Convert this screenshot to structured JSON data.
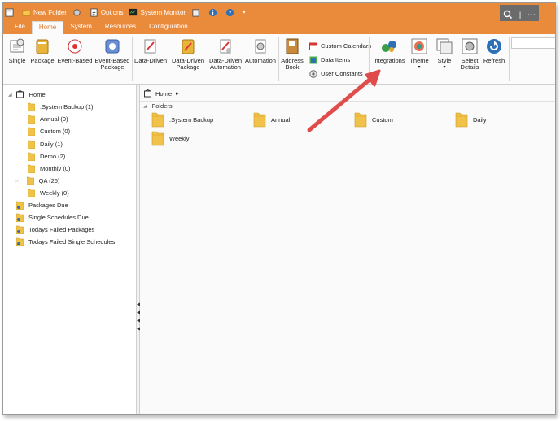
{
  "quick_access": {
    "new_folder": "New Folder",
    "options": "Options",
    "system_monitor": "System Monitor",
    "window_more": "⋯"
  },
  "tabs": [
    "File",
    "Home",
    "System",
    "Resources",
    "Configuration"
  ],
  "ribbon": {
    "buttons": [
      {
        "label": "Single",
        "icon": "single-schedule-icon"
      },
      {
        "label": "Package",
        "icon": "package-icon"
      },
      {
        "label": "Event-Based",
        "icon": "event-based-icon"
      },
      {
        "label": "Event-Based Package",
        "icon": "event-based-package-icon"
      },
      {
        "label": "Data-Driven",
        "icon": "data-driven-icon"
      },
      {
        "label": "Data-Driven Package",
        "icon": "data-driven-package-icon"
      },
      {
        "label": "Data-Driven Automation",
        "icon": "data-driven-automation-icon"
      },
      {
        "label": "Automation",
        "icon": "automation-icon"
      },
      {
        "label": "Address Book",
        "icon": "address-book-icon"
      }
    ],
    "small": [
      {
        "label": "Custom Calendars",
        "icon": "calendar-icon"
      },
      {
        "label": "Data Items",
        "icon": "data-items-icon"
      },
      {
        "label": "User Constants",
        "icon": "user-constants-icon"
      }
    ],
    "right": [
      {
        "label": "Integrations",
        "icon": "integrations-icon"
      },
      {
        "label": "Theme",
        "icon": "theme-icon"
      },
      {
        "label": "Style",
        "icon": "style-icon"
      },
      {
        "label": "Select Details",
        "icon": "select-details-icon"
      },
      {
        "label": "Refresh",
        "icon": "refresh-icon"
      }
    ]
  },
  "tree": {
    "root": "Home",
    "children": [
      ".System Backup (1)",
      "Annual (0)",
      "Custom (0)",
      "Daily (1)",
      "Demo (2)",
      "Monthly (0)",
      "QA (26)",
      "Weekly (0)"
    ],
    "special": [
      "Packages Due",
      "Single Schedules Due",
      "Todays Failed Packages",
      "Todays Failed Single Schedules"
    ]
  },
  "content": {
    "breadcrumb": "Home",
    "section": "Folders",
    "folders": [
      ".System Backup",
      "Annual",
      "Custom",
      "Daily",
      "Weekly"
    ]
  },
  "colors": {
    "accent": "#ea8a3b",
    "arrow": "#e04b4b",
    "folder": "#f1c24a"
  }
}
